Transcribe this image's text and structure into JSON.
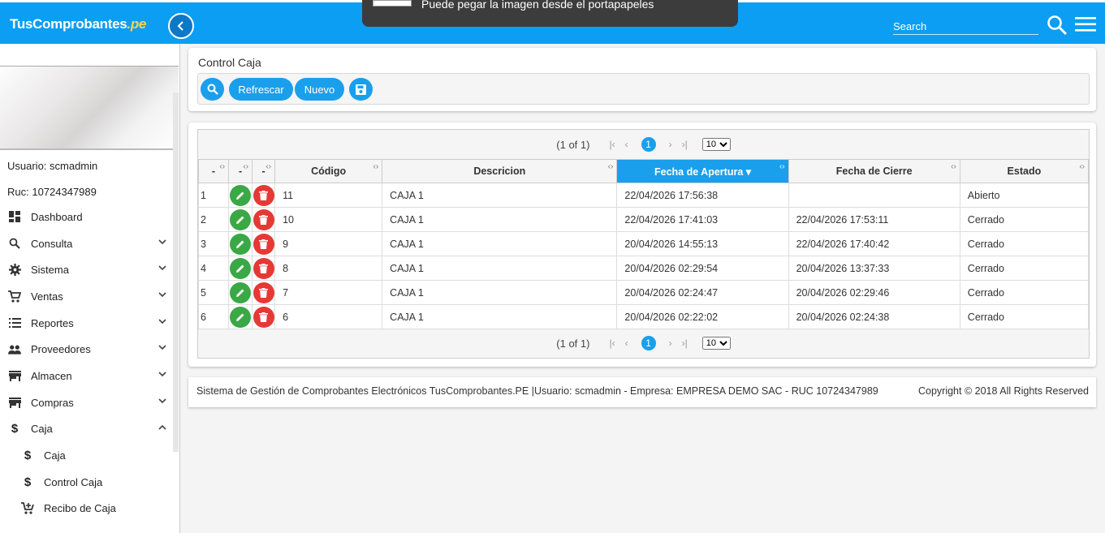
{
  "header": {
    "logo_main": "TusComprobantes",
    "logo_suffix": ".pe",
    "search_placeholder": "Search",
    "toast": "Puede pegar la imagen desde el portapapeles"
  },
  "sidebar": {
    "user": "Usuario: scmadmin",
    "ruc": "Ruc: 10724347989",
    "items": [
      {
        "label": "Dashboard",
        "icon": "dashboard-icon"
      },
      {
        "label": "Consulta",
        "icon": "search-icon"
      },
      {
        "label": "Sistema",
        "icon": "gear-icon"
      },
      {
        "label": "Ventas",
        "icon": "cart-icon"
      },
      {
        "label": "Reportes",
        "icon": "list-icon"
      },
      {
        "label": "Proveedores",
        "icon": "people-icon"
      },
      {
        "label": "Almacen",
        "icon": "store-icon"
      },
      {
        "label": "Compras",
        "icon": "store-icon"
      },
      {
        "label": "Caja",
        "icon": "dollar-icon"
      },
      {
        "label": "Caja",
        "icon": "dollar-icon"
      },
      {
        "label": "Control Caja",
        "icon": "dollar-icon"
      },
      {
        "label": "Recibo de Caja",
        "icon": "cart-add-icon"
      }
    ]
  },
  "panel": {
    "title": "Control Caja",
    "btn_refresh": "Refrescar",
    "btn_new": "Nuevo"
  },
  "grid": {
    "page_report": "(1 of 1)",
    "current_page": "1",
    "rows_per_page": "10",
    "columns": [
      "-",
      "-",
      "-",
      "Código",
      "Descricion",
      "Fecha de Apertura",
      "Fecha de Cierre",
      "Estado"
    ],
    "rows": [
      {
        "n": "1",
        "codigo": "11",
        "desc": "CAJA 1",
        "apertura": "22/04/2026 17:56:38",
        "cierre": "",
        "estado": "Abierto"
      },
      {
        "n": "2",
        "codigo": "10",
        "desc": "CAJA 1",
        "apertura": "22/04/2026 17:41:03",
        "cierre": "22/04/2026 17:53:11",
        "estado": "Cerrado"
      },
      {
        "n": "3",
        "codigo": "9",
        "desc": "CAJA 1",
        "apertura": "20/04/2026 14:55:13",
        "cierre": "22/04/2026 17:40:42",
        "estado": "Cerrado"
      },
      {
        "n": "4",
        "codigo": "8",
        "desc": "CAJA 1",
        "apertura": "20/04/2026 02:29:54",
        "cierre": "20/04/2026 13:37:33",
        "estado": "Cerrado"
      },
      {
        "n": "5",
        "codigo": "7",
        "desc": "CAJA 1",
        "apertura": "20/04/2026 02:24:47",
        "cierre": "20/04/2026 02:29:46",
        "estado": "Cerrado"
      },
      {
        "n": "6",
        "codigo": "6",
        "desc": "CAJA 1",
        "apertura": "20/04/2026 02:22:02",
        "cierre": "20/04/2026 02:24:38",
        "estado": "Cerrado"
      }
    ]
  },
  "footer": {
    "left": "Sistema de Gestión de Comprobantes Electrónicos TusComprobantes.PE |Usuario: scmadmin - Empresa: EMPRESA DEMO SAC - RUC 10724347989",
    "right": "Copyright © 2018 All Rights Reserved"
  }
}
